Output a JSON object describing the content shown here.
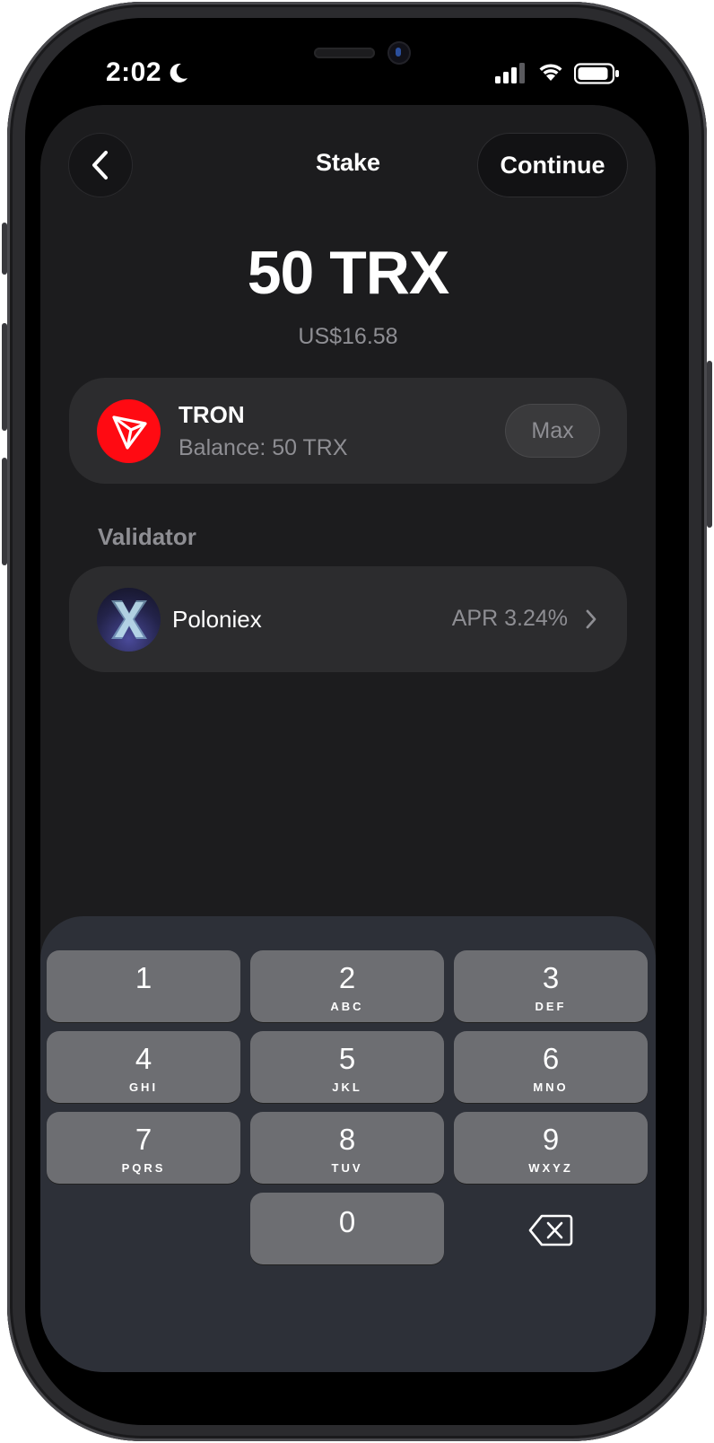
{
  "status_bar": {
    "time": "2:02",
    "icons": [
      "moon-icon",
      "cellular-signal-icon",
      "wifi-icon",
      "battery-icon"
    ]
  },
  "header": {
    "title": "Stake",
    "continue_label": "Continue",
    "back_icon": "chevron-left-icon"
  },
  "amount": {
    "value": "50 TRX",
    "fiat": "US$16.58"
  },
  "token": {
    "name": "TRON",
    "balance": "Balance: 50 TRX",
    "max_label": "Max",
    "logo_color": "#ff0a12"
  },
  "validator": {
    "section_label": "Validator",
    "name": "Poloniex",
    "apr": "APR 3.24%"
  },
  "keypad": {
    "keys": [
      {
        "digit": "1",
        "letters": ""
      },
      {
        "digit": "2",
        "letters": "ABC"
      },
      {
        "digit": "3",
        "letters": "DEF"
      },
      {
        "digit": "4",
        "letters": "GHI"
      },
      {
        "digit": "5",
        "letters": "JKL"
      },
      {
        "digit": "6",
        "letters": "MNO"
      },
      {
        "digit": "7",
        "letters": "PQRS"
      },
      {
        "digit": "8",
        "letters": "TUV"
      },
      {
        "digit": "9",
        "letters": "WXYZ"
      },
      {
        "digit": "0",
        "letters": ""
      }
    ],
    "delete_icon": "backspace-icon"
  },
  "colors": {
    "screen_bg": "#1c1c1e",
    "card_bg": "#2c2c2e",
    "keyboard_bg": "#2d3038",
    "key_bg": "#6d6e72",
    "secondary_text": "#8e8e93"
  }
}
